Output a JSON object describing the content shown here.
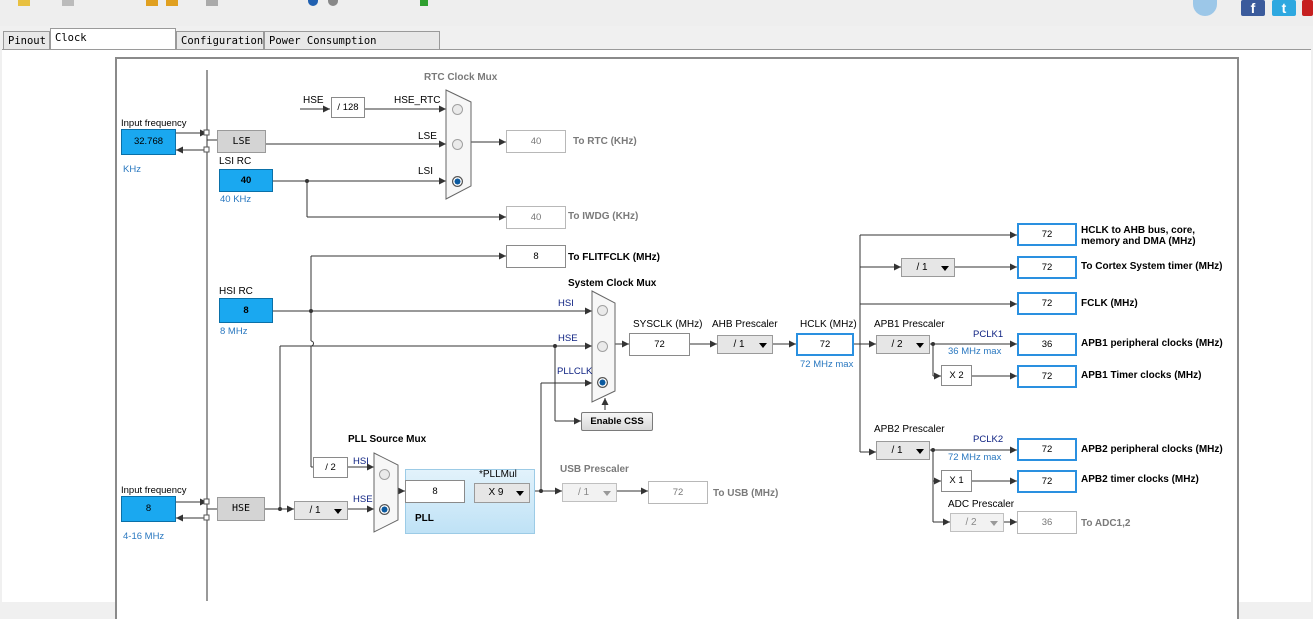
{
  "tabs": [
    {
      "label": "Pinout"
    },
    {
      "label": "Clock Configuration"
    },
    {
      "label": "Configuration"
    },
    {
      "label": "Power Consumption Calculator"
    }
  ],
  "active_tab": "Clock Configuration",
  "social": {
    "facebook": "f",
    "twitter": "t"
  },
  "lse": {
    "input_label": "Input frequency",
    "input_value": "32.768",
    "unit": "KHz",
    "name": "LSE"
  },
  "lsi": {
    "name": "LSI RC",
    "value": "40",
    "unit": "40 KHz"
  },
  "rtc_mux": {
    "title": "RTC Clock Mux",
    "hse_label": "HSE",
    "div_label": "/ 128",
    "hse_rtc_label": "HSE_RTC",
    "lse_label": "LSE",
    "lsi_label": "LSI",
    "rtc_value": "40",
    "rtc_label": "To RTC (KHz)",
    "iwdg_value": "40",
    "iwdg_label": "To IWDG (KHz)",
    "selected": "LSI"
  },
  "flitf": {
    "value": "8",
    "label": "To FLITFCLK (MHz)"
  },
  "hsi": {
    "name": "HSI RC",
    "value": "8",
    "unit": "8 MHz"
  },
  "sys_mux": {
    "title": "System Clock Mux",
    "hsi_label": "HSI",
    "hse_label": "HSE",
    "pll_label": "PLLCLK",
    "selected": "PLLCLK",
    "css_button": "Enable CSS"
  },
  "sysclk": {
    "label": "SYSCLK (MHz)",
    "value": "72"
  },
  "ahb": {
    "label": "AHB Prescaler",
    "value": "/ 1"
  },
  "hclk": {
    "label": "HCLK (MHz)",
    "value": "72",
    "max": "72 MHz max"
  },
  "outputs": {
    "hclk_ahb": {
      "value": "72",
      "label_line1": "HCLK to AHB bus, core,",
      "label_line2": "memory and DMA (MHz)"
    },
    "cortex": {
      "divider": "/ 1",
      "value": "72",
      "label": "To Cortex System timer (MHz)"
    },
    "fclk": {
      "value": "72",
      "label": "FCLK (MHz)"
    }
  },
  "apb1": {
    "label": "APB1 Prescaler",
    "value": "/ 2",
    "pclk_label": "PCLK1",
    "max": "36 MHz max",
    "periph_value": "36",
    "periph_label": "APB1 peripheral clocks (MHz)",
    "timer_mult": "X 2",
    "timer_value": "72",
    "timer_label": "APB1 Timer clocks (MHz)"
  },
  "apb2": {
    "label": "APB2 Prescaler",
    "value": "/ 1",
    "pclk_label": "PCLK2",
    "max": "72 MHz max",
    "periph_value": "72",
    "periph_label": "APB2 peripheral clocks (MHz)",
    "timer_mult": "X 1",
    "timer_value": "72",
    "timer_label": "APB2 timer clocks (MHz)"
  },
  "adc": {
    "label": "ADC Prescaler",
    "value": "/ 2",
    "out_value": "36",
    "out_label": "To ADC1,2"
  },
  "pll_mux": {
    "title": "PLL Source Mux",
    "hsi_div": "/ 2",
    "hsi_label": "HSI",
    "hse_label": "HSE",
    "selected": "HSE"
  },
  "pll": {
    "input_value": "8",
    "mul_label": "*PLLMul",
    "mul_value": "X 9",
    "name": "PLL"
  },
  "usb": {
    "label": "USB Prescaler",
    "value": "/ 1",
    "out_value": "72",
    "out_label": "To USB (MHz)"
  },
  "hse": {
    "input_label": "Input frequency",
    "input_value": "8",
    "range": "4-16 MHz",
    "name": "HSE",
    "prediv": "/ 1"
  }
}
